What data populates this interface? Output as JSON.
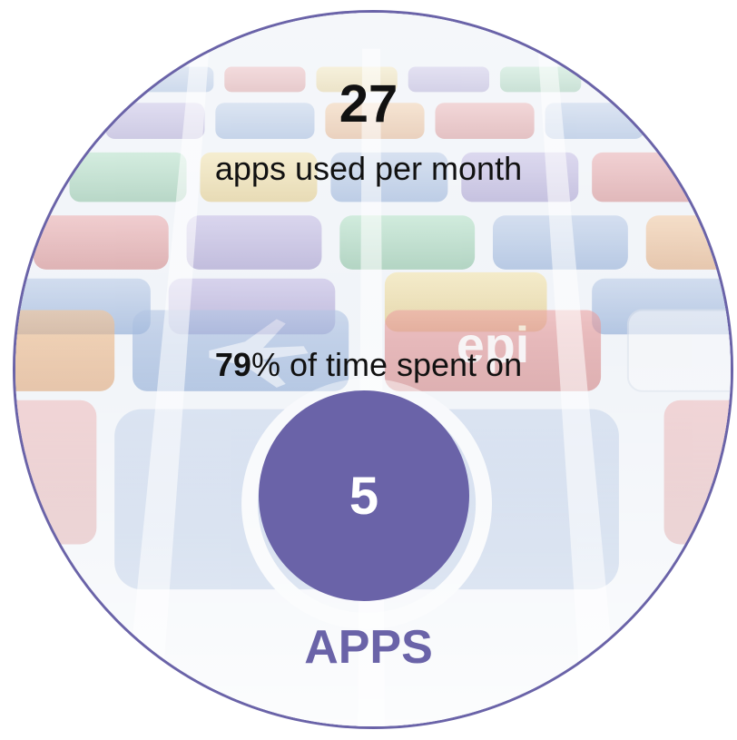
{
  "stat_monthly": {
    "value": "27",
    "label": "apps used per month"
  },
  "stat_time": {
    "percent": "79",
    "rest": "% of time spent on"
  },
  "apps_count": {
    "value": "5",
    "label": "APPS"
  },
  "colors": {
    "accent": "#6a63a8",
    "text": "#111111"
  },
  "background_icons": [
    "app-store-icon-grid",
    "epi-app-icon",
    "airplane-app-icon",
    "app-store-logo-icon"
  ]
}
